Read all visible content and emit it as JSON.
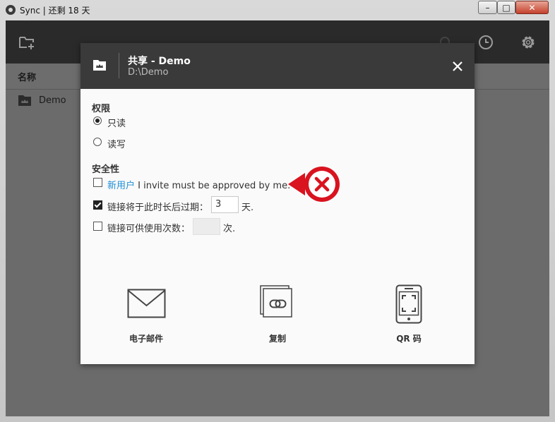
{
  "window": {
    "title": "Sync | 还剩 18 天",
    "min_label": "–",
    "max_label": "□",
    "close_label": "✕"
  },
  "list": {
    "column_header": "名称",
    "items": [
      {
        "name": "Demo"
      }
    ]
  },
  "dialog": {
    "title": "共享 - Demo",
    "path": "D:\\Demo",
    "permissions": {
      "heading": "权限",
      "options": [
        {
          "label": "只读",
          "selected": true
        },
        {
          "label": "读写",
          "selected": false
        }
      ]
    },
    "security": {
      "heading": "安全性",
      "approve": {
        "checked": false,
        "link_text": "新用户",
        "text": " I invite must be approved by me."
      },
      "expire": {
        "checked": true,
        "label": "链接将于此时长后过期：",
        "value": "3",
        "unit": "天."
      },
      "uses": {
        "checked": false,
        "label": "链接可供使用次数：",
        "value": "",
        "unit": "次."
      }
    },
    "share_options": [
      {
        "label": "电子邮件",
        "icon": "envelope-icon"
      },
      {
        "label": "复制",
        "icon": "copy-link-icon"
      },
      {
        "label": "QR 码",
        "icon": "qr-phone-icon"
      }
    ]
  },
  "colors": {
    "toolbar_bg": "#2a2a2a",
    "dialog_header_bg": "#3a3a3a",
    "link": "#1e8fd6",
    "callout_red": "#d9131f"
  }
}
